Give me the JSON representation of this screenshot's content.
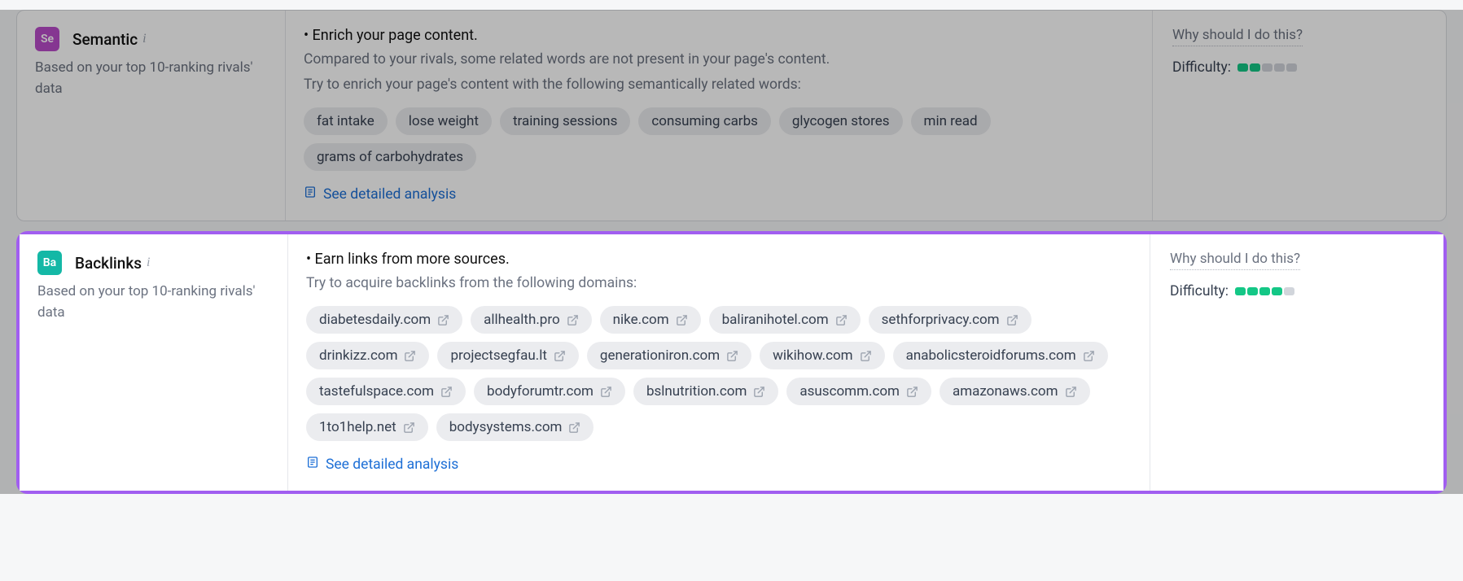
{
  "common": {
    "why_label": "Why should I do this?",
    "difficulty_label": "Difficulty:",
    "detail_link": "See detailed analysis",
    "subtitle": "Based on your top 10-ranking rivals' data"
  },
  "semantic": {
    "badge": "Se",
    "title": "Semantic",
    "heading": "• Enrich your page content.",
    "desc1": "Compared to your rivals, some related words are not present in your page's content.",
    "desc2": "Try to enrich your page's content with the following semantically related words:",
    "chips": [
      "fat intake",
      "lose weight",
      "training sessions",
      "consuming carbs",
      "glycogen stores",
      "min read",
      "grams of carbohydrates"
    ],
    "difficulty_filled": 2,
    "difficulty_total": 5
  },
  "backlinks": {
    "badge": "Ba",
    "title": "Backlinks",
    "heading": "• Earn links from more sources.",
    "desc1": "Try to acquire backlinks from the following domains:",
    "chips": [
      "diabetesdaily.com",
      "allhealth.pro",
      "nike.com",
      "baliranihotel.com",
      "sethforprivacy.com",
      "drinkizz.com",
      "projectsegfau.lt",
      "generationiron.com",
      "wikihow.com",
      "anabolicsteroidforums.com",
      "tastefulspace.com",
      "bodyforumtr.com",
      "bslnutrition.com",
      "asuscomm.com",
      "amazonaws.com",
      "1to1help.net",
      "bodysystems.com"
    ],
    "difficulty_filled": 4,
    "difficulty_total": 5
  }
}
